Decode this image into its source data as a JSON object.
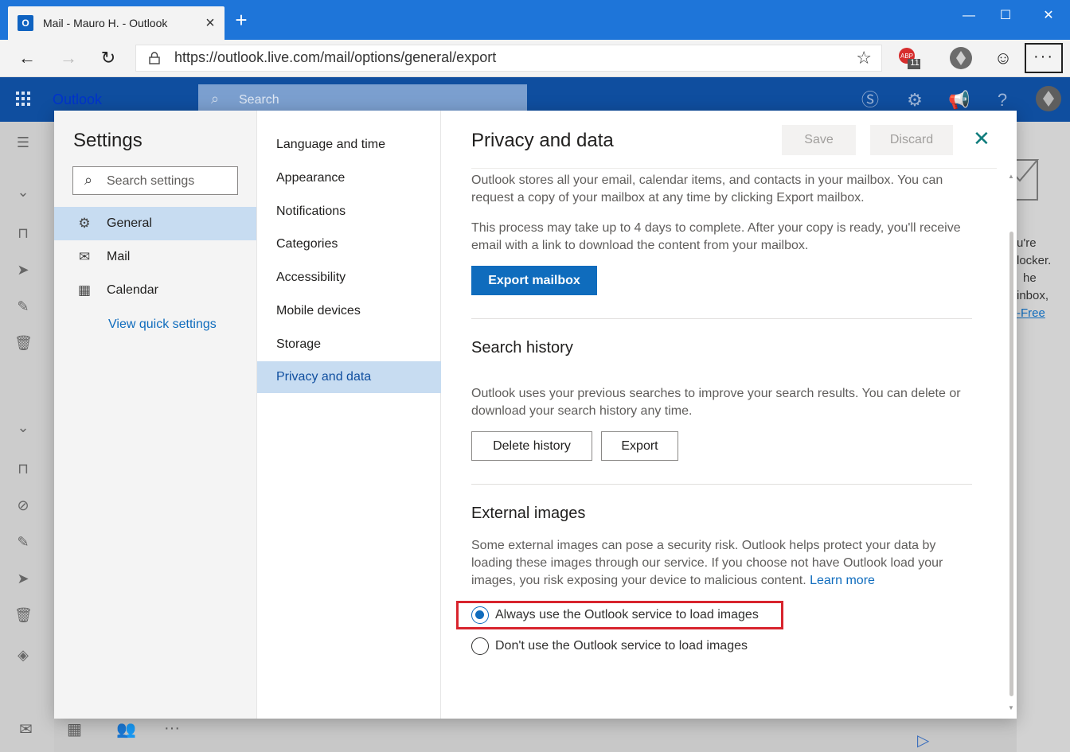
{
  "browser": {
    "tab_title": "Mail - Mauro H. - Outlook",
    "favicon_letter": "O",
    "url": "https://outlook.live.com/mail/options/general/export",
    "badge_count": "11"
  },
  "outlook": {
    "brand": "Outlook",
    "search_placeholder": "Search"
  },
  "settings": {
    "title": "Settings",
    "search_placeholder": "Search settings",
    "categories": [
      {
        "label": "General",
        "icon": "gear-icon",
        "selected": true
      },
      {
        "label": "Mail",
        "icon": "mail-icon",
        "selected": false
      },
      {
        "label": "Calendar",
        "icon": "calendar-icon",
        "selected": false
      }
    ],
    "quick_settings_link": "View quick settings",
    "subcategories": [
      {
        "label": "Language and time"
      },
      {
        "label": "Appearance"
      },
      {
        "label": "Notifications"
      },
      {
        "label": "Categories"
      },
      {
        "label": "Accessibility"
      },
      {
        "label": "Mobile devices"
      },
      {
        "label": "Storage"
      },
      {
        "label": "Privacy and data",
        "selected": true
      }
    ]
  },
  "pane": {
    "title": "Privacy and data",
    "save_label": "Save",
    "discard_label": "Discard",
    "export_mailbox": {
      "para1": "Outlook stores all your email, calendar items, and contacts in your mailbox. You can request a copy of your mailbox at any time by clicking Export mailbox.",
      "para2": "This process may take up to 4 days to complete. After your copy is ready, you'll receive email with a link to download the content from your mailbox.",
      "button": "Export mailbox"
    },
    "search_history": {
      "title": "Search history",
      "para": "Outlook uses your previous searches to improve your search results. You can delete or download your search history any time.",
      "delete_button": "Delete history",
      "export_button": "Export"
    },
    "external_images": {
      "title": "External images",
      "para": "Some external images can pose a security risk. Outlook helps protect your data by loading these images through our service. If you choose not have Outlook load your images, you risk exposing your device to malicious content.",
      "learn_more": "Learn more",
      "options": [
        {
          "label": "Always use the Outlook service to load images",
          "checked": true
        },
        {
          "label": "Don't use the Outlook service to load images",
          "checked": false
        }
      ]
    }
  },
  "background_right": {
    "lines": [
      "u're",
      "locker.",
      "he",
      "inbox,",
      "-Free"
    ]
  },
  "colors": {
    "accent": "#0f6cbd",
    "header": "#0f4e9f",
    "tabstrip": "#1e75d9",
    "highlight": "#d8242d",
    "selected_bg": "#c7dcf1"
  }
}
